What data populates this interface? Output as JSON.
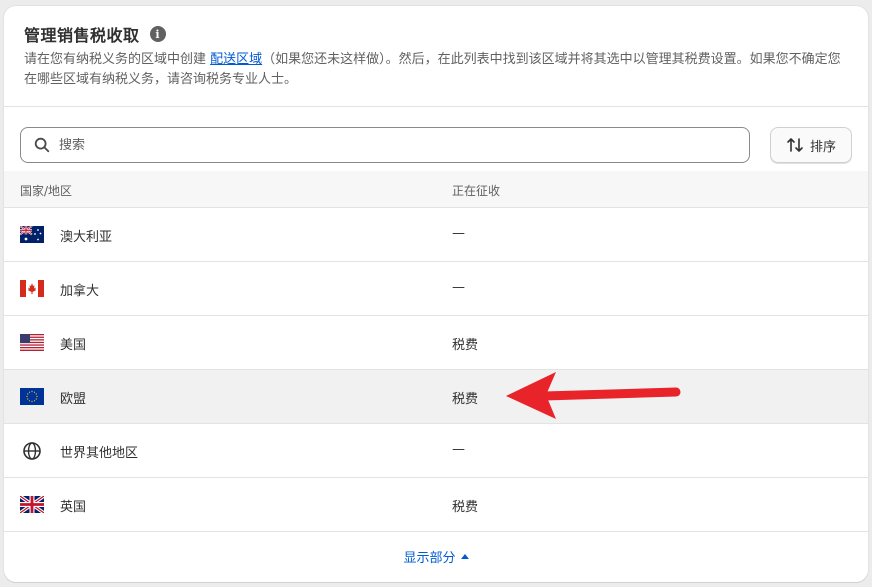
{
  "header": {
    "title": "管理销售税收取",
    "info_icon": "info-icon",
    "desc_before": "请在您有纳税义务的区域中创建 ",
    "desc_link": "配送区域",
    "desc_after": "（如果您还未这样做）。然后，在此列表中找到该区域并将其选中以管理其税费设置。如果您不确定您在哪些区域有纳税义务，请咨询税务专业人士。"
  },
  "search": {
    "placeholder": "搜索",
    "value": ""
  },
  "sort": {
    "label": "排序",
    "icon": "sort-arrows-icon"
  },
  "table": {
    "headers": {
      "country": "国家/地区",
      "collecting": "正在征收"
    },
    "rows": [
      {
        "name": "澳大利亚",
        "collecting": "—",
        "icon": "flag-australia-icon"
      },
      {
        "name": "加拿大",
        "collecting": "—",
        "icon": "flag-canada-icon"
      },
      {
        "name": "美国",
        "collecting": "税费",
        "icon": "flag-usa-icon"
      },
      {
        "name": "欧盟",
        "collecting": "税费",
        "icon": "flag-eu-icon"
      },
      {
        "name": "世界其他地区",
        "collecting": "—",
        "icon": "globe-icon"
      },
      {
        "name": "英国",
        "collecting": "税费",
        "icon": "flag-uk-icon"
      }
    ]
  },
  "footer": {
    "show_less": "显示部分"
  },
  "colors": {
    "link": "#005bd3",
    "annotation_arrow": "#e8232a",
    "highlight_row": "#f1f1f1"
  }
}
